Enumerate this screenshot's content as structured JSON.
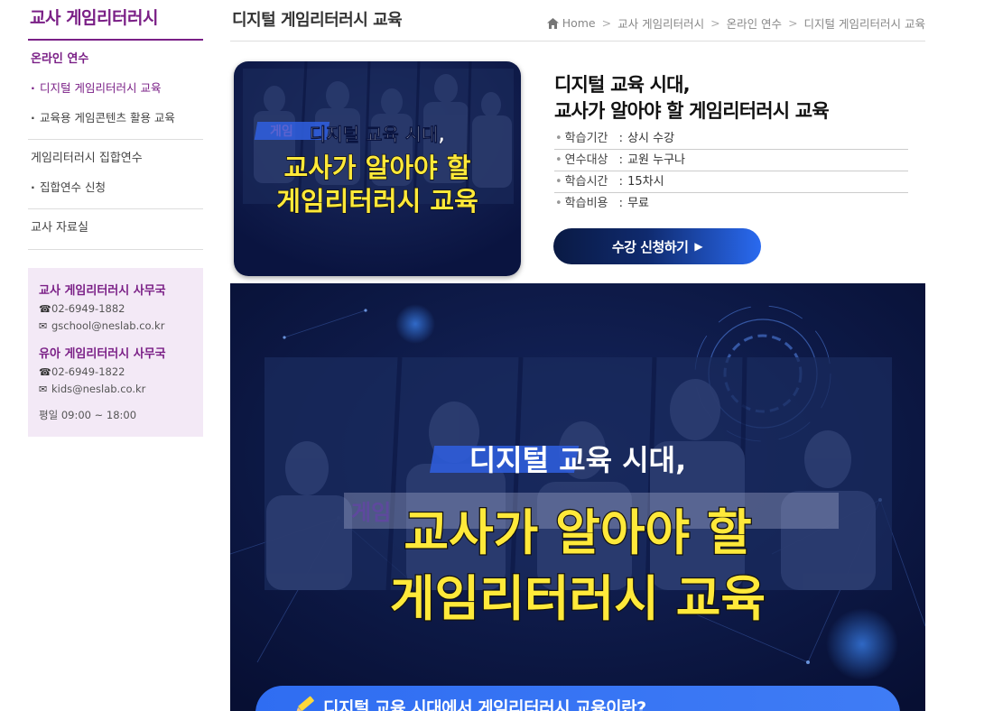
{
  "sidebar": {
    "title": "교사 게임리터러시",
    "groups": [
      {
        "label": "온라인 연수",
        "items": [
          "디지털 게임리터러시 교육",
          "교육용 게임콘텐츠 활용 교육"
        ]
      },
      {
        "label": "게임리터러시 집합연수",
        "items": [
          "집합연수 신청"
        ]
      },
      {
        "label": "교사 자료실",
        "items": []
      }
    ],
    "contact": {
      "teacher": {
        "title": "교사 게임리터러시 사무국",
        "phone": "02-6949-1882",
        "email": "gschool@neslab.co.kr"
      },
      "kids": {
        "title": "유아 게임리터러시 사무국",
        "phone": "02-6949-1822",
        "email": "kids@neslab.co.kr"
      },
      "hours": "평일 09:00 ~ 18:00"
    }
  },
  "header": {
    "title": "디지털 게임리터러시 교육",
    "breadcrumb": [
      "Home",
      "교사 게임리터러시",
      "온라인 연수",
      "디지털 게임리터러시 교육"
    ]
  },
  "course": {
    "title_line1": "디지털 교육 시대,",
    "title_line2": "교사가 알아야 할 게임리터러시 교육",
    "details": [
      {
        "key": "학습기간",
        "value": "상시 수강"
      },
      {
        "key": "연수대상",
        "value": "교원 누구나"
      },
      {
        "key": "학습시간",
        "value": "15차시"
      },
      {
        "key": "학습비용",
        "value": "무료"
      }
    ],
    "apply_label": "수강 신청하기"
  },
  "thumbnail": {
    "line1": "디지털 교육 시대,",
    "line2": "교사가 알아야 할",
    "line3": "게임리터러시 교육",
    "faint": "게임"
  },
  "banner": {
    "line1": "디지털 교육 시대,",
    "line2": "교사가 알아야 할",
    "line3": "게임리터러시 교육",
    "faint": "게임",
    "bottom_text": "디지털 교육 시대에서 게임리터러시 교육이란?"
  },
  "colors": {
    "brand_purple": "#7a1f86",
    "navy": "#0a1440",
    "yellow": "#ffe93a",
    "blue": "#2f6df2"
  }
}
